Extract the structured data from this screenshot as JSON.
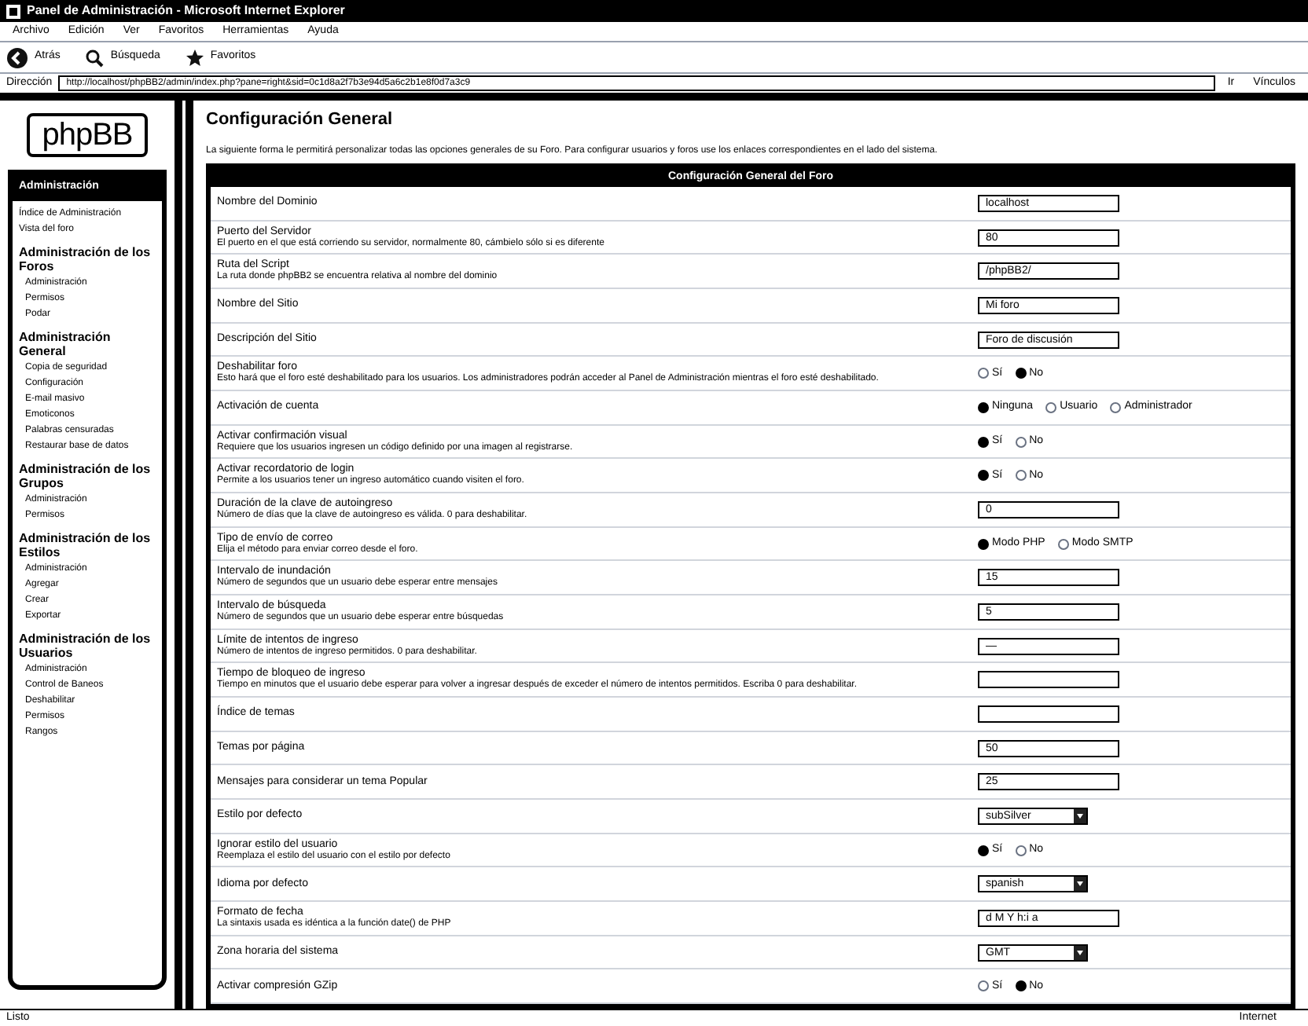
{
  "window": {
    "title": "Panel de Administración - Microsoft Internet Explorer"
  },
  "menu": [
    "Archivo",
    "Edición",
    "Ver",
    "Favoritos",
    "Herramientas",
    "Ayuda"
  ],
  "toolbar": [
    {
      "kind": "back",
      "label": "Atrás"
    },
    {
      "kind": "search",
      "label": "Búsqueda"
    },
    {
      "kind": "favorites",
      "label": "Favoritos"
    }
  ],
  "address": {
    "label": "Dirección",
    "value": "http://localhost/phpBB2/admin/index.php?pane=right&sid=0c1d8a2f7b3e94d5a6c2b1e8f0d7a3c9"
  },
  "go": "Ir",
  "links": "Vínculos",
  "sidebar": {
    "logo": "phpBB",
    "header": "Administración",
    "top_items": [
      "Índice de Administración",
      "Vista del foro"
    ],
    "sections": [
      {
        "title": "Administración de los Foros",
        "items": [
          "Administración",
          "Permisos",
          "Podar"
        ]
      },
      {
        "title": "Administración General",
        "items": [
          "Copia de seguridad",
          "Configuración",
          "E-mail masivo",
          "Emoticonos",
          "Palabras censuradas",
          "Restaurar base de datos"
        ]
      },
      {
        "title": "Administración de los Grupos",
        "items": [
          "Administración",
          "Permisos"
        ]
      },
      {
        "title": "Administración de los Estilos",
        "items": [
          "Administración",
          "Agregar",
          "Crear",
          "Exportar"
        ]
      },
      {
        "title": "Administración de los Usuarios",
        "items": [
          "Administración",
          "Control de Baneos",
          "Deshabilitar",
          "Permisos",
          "Rangos"
        ]
      }
    ]
  },
  "main": {
    "title": "Configuración General",
    "intro": "La siguiente forma le permitirá personalizar todas las opciones generales de su Foro. Para configurar usuarios y foros use los enlaces correspondientes en el lado del sistema.",
    "table_header": "Configuración General del Foro",
    "rows": [
      {
        "kind": "text",
        "label": "Nombre del Dominio",
        "value": "localhost"
      },
      {
        "kind": "text",
        "label": "Puerto del Servidor",
        "description": "El puerto en el que está corriendo su servidor, normalmente 80, cámbielo sólo si es diferente",
        "value": "80"
      },
      {
        "kind": "text",
        "label": "Ruta del Script",
        "description": "La ruta donde phpBB2 se encuentra relativa al nombre del dominio",
        "value": "/phpBB2/"
      },
      {
        "kind": "text",
        "label": "Nombre del Sitio",
        "value": "Mi foro"
      },
      {
        "kind": "text",
        "label": "Descripción del Sitio",
        "value": "Foro de discusión"
      },
      {
        "kind": "radio",
        "label": "Deshabilitar foro",
        "description": "Esto hará que el foro esté deshabilitado para los usuarios. Los administradores podrán acceder al Panel de Administración mientras el foro esté deshabilitado.",
        "options": [
          {
            "label": "Sí",
            "selected": false
          },
          {
            "label": "No",
            "selected": true
          }
        ]
      },
      {
        "kind": "radio",
        "label": "Activación de cuenta",
        "options": [
          {
            "label": "Ninguna",
            "selected": true
          },
          {
            "label": "Usuario",
            "selected": false
          },
          {
            "label": "Administrador",
            "selected": false
          }
        ]
      },
      {
        "kind": "radio",
        "label": "Activar confirmación visual",
        "description": "Requiere que los usuarios ingresen un código definido por una imagen al registrarse.",
        "options": [
          {
            "label": "Sí",
            "selected": true
          },
          {
            "label": "No",
            "selected": false
          }
        ]
      },
      {
        "kind": "radio",
        "label": "Activar recordatorio de login",
        "description": "Permite a los usuarios tener un ingreso automático cuando visiten el foro.",
        "options": [
          {
            "label": "Sí",
            "selected": true
          },
          {
            "label": "No",
            "selected": false
          }
        ]
      },
      {
        "kind": "text",
        "label": "Duración de la clave de autoingreso",
        "description": "Número de días que la clave de autoingreso es válida. 0 para deshabilitar.",
        "value": "0"
      },
      {
        "kind": "radio",
        "label": "Tipo de envío de correo",
        "description": "Elija el método para enviar correo desde el foro.",
        "options": [
          {
            "label": "Modo PHP",
            "selected": true
          },
          {
            "label": "Modo SMTP",
            "selected": false
          }
        ]
      },
      {
        "kind": "text",
        "label": "Intervalo de inundación",
        "description": "Número de segundos que un usuario debe esperar entre mensajes",
        "value": "15"
      },
      {
        "kind": "text",
        "label": "Intervalo de búsqueda",
        "description": "Número de segundos que un usuario debe esperar entre búsquedas",
        "value": "5"
      },
      {
        "kind": "text",
        "label": "Límite de intentos de ingreso",
        "description": "Número de intentos de ingreso permitidos. 0 para deshabilitar.",
        "value": "—"
      },
      {
        "kind": "text",
        "label": "Tiempo de bloqueo de ingreso",
        "description": "Tiempo en minutos que el usuario debe esperar para volver a ingresar después de exceder el número de intentos permitidos. Escriba 0 para deshabilitar.",
        "value": ""
      },
      {
        "kind": "text",
        "label": "Índice de temas",
        "value": ""
      },
      {
        "kind": "text",
        "label": "Temas por página",
        "value": "50"
      },
      {
        "kind": "text",
        "label": "Mensajes para considerar un tema Popular",
        "value": "25"
      },
      {
        "kind": "select",
        "label": "Estilo por defecto",
        "value": "subSilver"
      },
      {
        "kind": "radio",
        "label": "Ignorar estilo del usuario",
        "description": "Reemplaza el estilo del usuario con el estilo por defecto",
        "options": [
          {
            "label": "Sí",
            "selected": true
          },
          {
            "label": "No",
            "selected": false
          }
        ]
      },
      {
        "kind": "select",
        "label": "Idioma por defecto",
        "value": "spanish"
      },
      {
        "kind": "text",
        "label": "Formato de fecha",
        "description": "La sintaxis usada es idéntica a la función date() de PHP",
        "value": "d M Y h:i a"
      },
      {
        "kind": "select",
        "label": "Zona horaria del sistema",
        "value": "GMT"
      },
      {
        "kind": "radio",
        "label": "Activar compresión GZip",
        "options": [
          {
            "label": "Sí",
            "selected": false
          },
          {
            "label": "No",
            "selected": true
          }
        ]
      }
    ]
  },
  "status_bar": {
    "text": "Listo",
    "zone": "Internet"
  }
}
